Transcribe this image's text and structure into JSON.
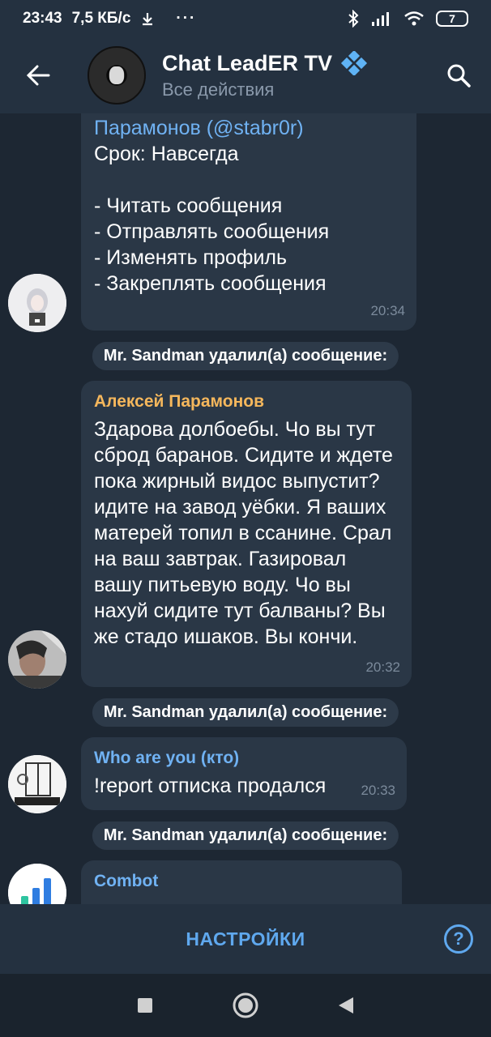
{
  "status_bar": {
    "time": "23:43",
    "speed": "7,5 КБ/с",
    "dots": "···",
    "battery": "7"
  },
  "header": {
    "title": "Chat LeadER TV",
    "subtitle": "Все действия"
  },
  "messages": [
    {
      "type": "partial",
      "top_line_name": "Парамонов",
      "top_line_username": "(@stabr0r)",
      "body_lines": "Срок: Навсегда\n\n- Читать сообщения\n- Отправлять сообщения\n- Изменять профиль\n- Закреплять сообщения",
      "time": "20:34"
    },
    {
      "type": "service",
      "text": "Mr. Sandman удалил(а) сообщение:"
    },
    {
      "type": "message",
      "sender": "Алексей Парамонов",
      "sender_color": "#f5b75c",
      "text": "Здарова долбоебы. Чо вы тут сброд баранов. Сидите и ждете пока жирный видос выпустит? идите на завод уёбки. Я ваших матерей топил в ссанине. Срал на ваш завтрак. Газировал вашу питьевую воду. Чо вы нахуй сидите тут балваны? Вы же стадо ишаков. Вы кончи.",
      "time": "20:32"
    },
    {
      "type": "service",
      "text": "Mr. Sandman удалил(а) сообщение:"
    },
    {
      "type": "message",
      "sender": "Who are you (кто)",
      "sender_color": "#70b2f3",
      "text": "!report отписка продался",
      "time": "20:33"
    },
    {
      "type": "service",
      "text": "Mr. Sandman удалил(а) сообщение:"
    },
    {
      "type": "message",
      "sender": "Combot",
      "sender_color": "#70b2f3",
      "text": "",
      "time": ""
    }
  ],
  "bottom_bar": {
    "settings_label": "НАСТРОЙКИ",
    "help_label": "?"
  },
  "colors": {
    "background": "#1d2733",
    "header": "#243140",
    "bubble": "#2a3746",
    "accent": "#5fa8ee"
  }
}
